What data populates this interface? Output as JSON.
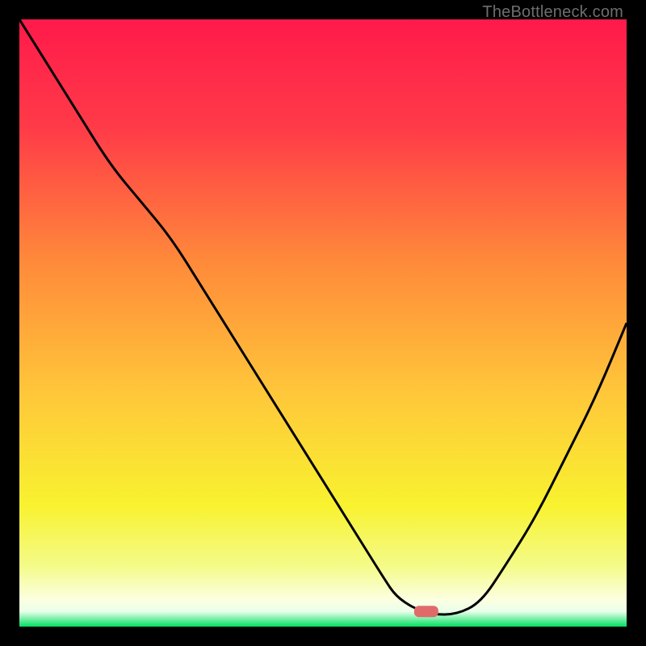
{
  "watermark": "TheBottleneck.com",
  "chart_data": {
    "type": "line",
    "title": "",
    "xlabel": "",
    "ylabel": "",
    "xlim": [
      0,
      100
    ],
    "ylim": [
      0,
      100
    ],
    "grid": false,
    "legend": false,
    "gradient_stops": [
      {
        "offset": 0.0,
        "color": "#ff1a4b"
      },
      {
        "offset": 0.18,
        "color": "#ff3b48"
      },
      {
        "offset": 0.4,
        "color": "#ff8a3a"
      },
      {
        "offset": 0.62,
        "color": "#ffc83a"
      },
      {
        "offset": 0.8,
        "color": "#f8f22f"
      },
      {
        "offset": 0.9,
        "color": "#f4fb88"
      },
      {
        "offset": 0.955,
        "color": "#fcffe0"
      },
      {
        "offset": 0.975,
        "color": "#eaffea"
      },
      {
        "offset": 1.0,
        "color": "#00e060"
      }
    ],
    "marker": {
      "x": 67,
      "y": 2.5,
      "color": "#e06a6a"
    },
    "series": [
      {
        "name": "bottleneck-curve",
        "x": [
          0,
          5,
          10,
          15,
          20,
          25,
          30,
          35,
          40,
          45,
          50,
          55,
          60,
          62,
          65,
          68,
          72,
          76,
          80,
          85,
          90,
          95,
          100
        ],
        "y": [
          100,
          92,
          84,
          76,
          70,
          64,
          56,
          48,
          40,
          32,
          24,
          16,
          8,
          5,
          3,
          2,
          2,
          4,
          10,
          18,
          28,
          38,
          50
        ]
      }
    ]
  }
}
